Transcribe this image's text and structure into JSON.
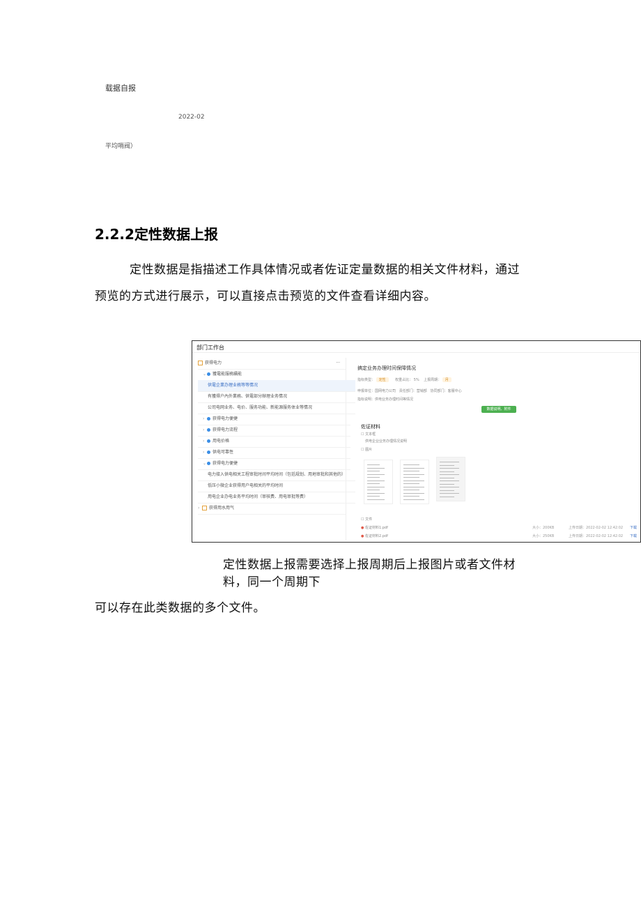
{
  "top_block": {
    "label1": "载据自报",
    "date": "2022-02",
    "label2": "平均哨阀）"
  },
  "section": {
    "heading": "2.2.2定性数据上报",
    "para_line1": "定性数据是指描述工作具体情况或者佐证定量数据的相关文件材料，通过",
    "para_line2": "预览的方式进行展示，可以直接点击预览的文件查看详细内容。"
  },
  "screenshot": {
    "window_title": "部门工作台",
    "tree": [
      {
        "label": "获得电力",
        "level": 0,
        "marker": "square",
        "more": "···"
      },
      {
        "label": "獲電能服務續能",
        "level": 1,
        "marker": "dot",
        "chevron": "v"
      },
      {
        "label": "供電企業办理业務等等情况",
        "level": 2,
        "selected": true
      },
      {
        "label": "有獲得户內外業務、供電部分辦理业务情况",
        "level": 2
      },
      {
        "label": "公司电网业务、电价、服务功能、新能源服务体业等情况",
        "level": 2
      },
      {
        "label": "获得电力便捷",
        "level": 1,
        "marker": "dot",
        "chevron": ">"
      },
      {
        "label": "获得电力流程",
        "level": 1,
        "marker": "dot",
        "chevron": ">"
      },
      {
        "label": "用电价格",
        "level": 1,
        "marker": "dot",
        "chevron": ">"
      },
      {
        "label": "供电可靠性",
        "level": 1,
        "marker": "dot",
        "chevron": ">"
      },
      {
        "label": "获得电力便捷",
        "level": 1,
        "marker": "dot",
        "chevron": "v"
      },
      {
        "label": "电力接入供电相关工程审批时间平均时间（包括规划、用地审批和其他的）",
        "level": 2
      },
      {
        "label": "低压小微企业获得用户电相关的平均时间",
        "level": 2
      },
      {
        "label": "用电企业办电业务平均时间（审核费、用电审批等费）",
        "level": 2
      },
      {
        "label": "获得用水用气",
        "level": 0,
        "marker": "square",
        "chevron": ">"
      }
    ],
    "detail": {
      "title": "搞定业务办理时间保障情况",
      "status_label": "指标类型：",
      "status_value": "定性",
      "weight_label": "权重占比：",
      "weight_value": "5%",
      "period_label": "上报周期：",
      "period_value": "月",
      "row2_a": "申报单位：国网电力公司",
      "row2_b": "责任部门：营销部",
      "row2_c": "协同部门：客服中心",
      "row3": "指标说明：供电业务办理时间等情况",
      "green_button": "数据说明、附件",
      "section": "佐证材料",
      "sub_text": "文本框",
      "sub_text_desc": "供电企业业务办理情况说明",
      "sub_image": "图片",
      "sub_file": "文件",
      "files": [
        {
          "name": "佐证材料1.pdf",
          "size": "大小：200KB",
          "time": "上传日期：2022-02-02 12:42:02",
          "action": "下载"
        },
        {
          "name": "佐证材料2.pdf",
          "size": "大小：250KB",
          "time": "上传日期：2022-02-02 12:42:02",
          "action": "下载"
        }
      ]
    }
  },
  "caption": {
    "line1": "定性数据上报需要选择上报周期后上报图片或者文件材",
    "line2": "料，同一个周期下"
  },
  "tail": "可以存在此类数据的多个文件。",
  "colors": {
    "accent_blue": "#3a8ee6",
    "green": "#4cb050",
    "orange": "#e4a23c"
  }
}
